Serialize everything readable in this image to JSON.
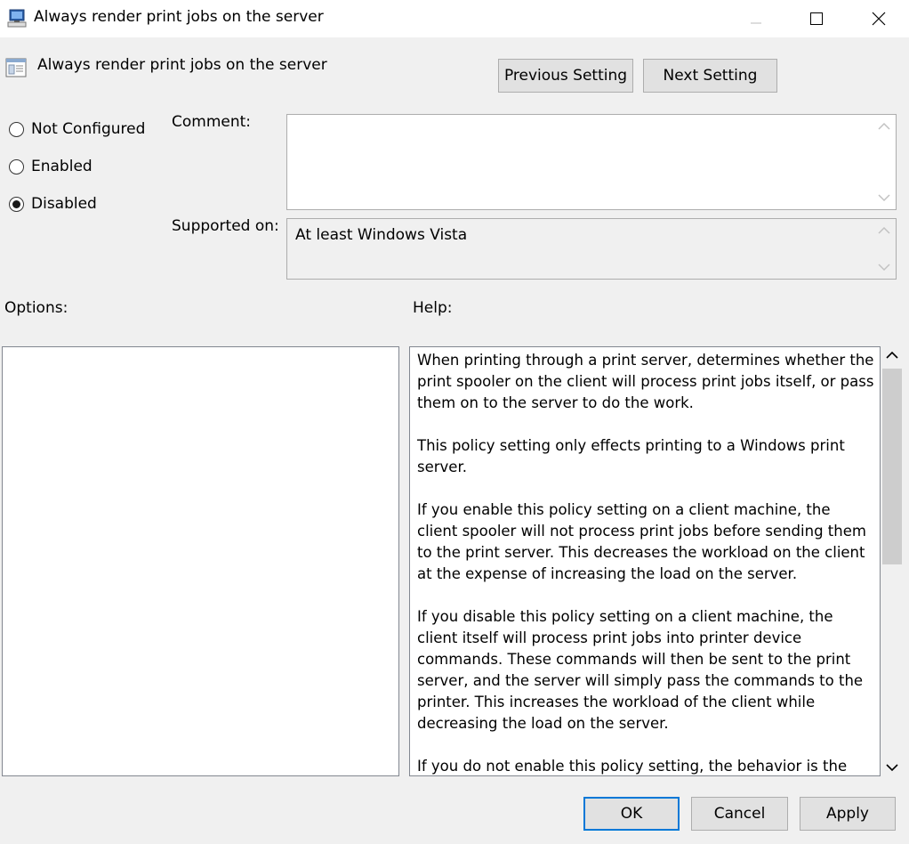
{
  "window": {
    "title": "Always render print jobs on the server",
    "controls": {
      "minimize": "minimize-icon",
      "maximize": "maximize-icon",
      "close": "close-icon"
    }
  },
  "header": {
    "setting_title": "Always render print jobs on the server",
    "previous_label": "Previous Setting",
    "next_label": "Next Setting"
  },
  "state": {
    "options": [
      {
        "label": "Not Configured",
        "checked": false
      },
      {
        "label": "Enabled",
        "checked": false
      },
      {
        "label": "Disabled",
        "checked": true
      }
    ]
  },
  "comment": {
    "label": "Comment:",
    "value": ""
  },
  "supported": {
    "label": "Supported on:",
    "value": "At least Windows Vista"
  },
  "options_section": {
    "label": "Options:"
  },
  "help": {
    "label": "Help:",
    "paragraphs": [
      "When printing through a print server, determines whether the print spooler on the client will process print jobs itself, or pass them on to the server to do the work.",
      "This policy setting only effects printing to a Windows print server.",
      "If you enable this policy setting on a client machine, the client spooler will not process print jobs before sending them to the print server. This decreases the workload on the client at the expense of increasing the load on the server.",
      "If you disable this policy setting on a client machine, the client itself will process print jobs into printer device commands. These commands will then be sent to the print server, and the server will simply pass the commands to the printer. This increases the workload of the client while decreasing the load on the server.",
      "If you do not enable this policy setting, the behavior is the same as disabling it."
    ]
  },
  "footer": {
    "ok_label": "OK",
    "cancel_label": "Cancel",
    "apply_label": "Apply"
  },
  "colors": {
    "focus_border": "#0078d7",
    "button_face": "#e1e1e1",
    "window_bg": "#f0f0f0"
  }
}
